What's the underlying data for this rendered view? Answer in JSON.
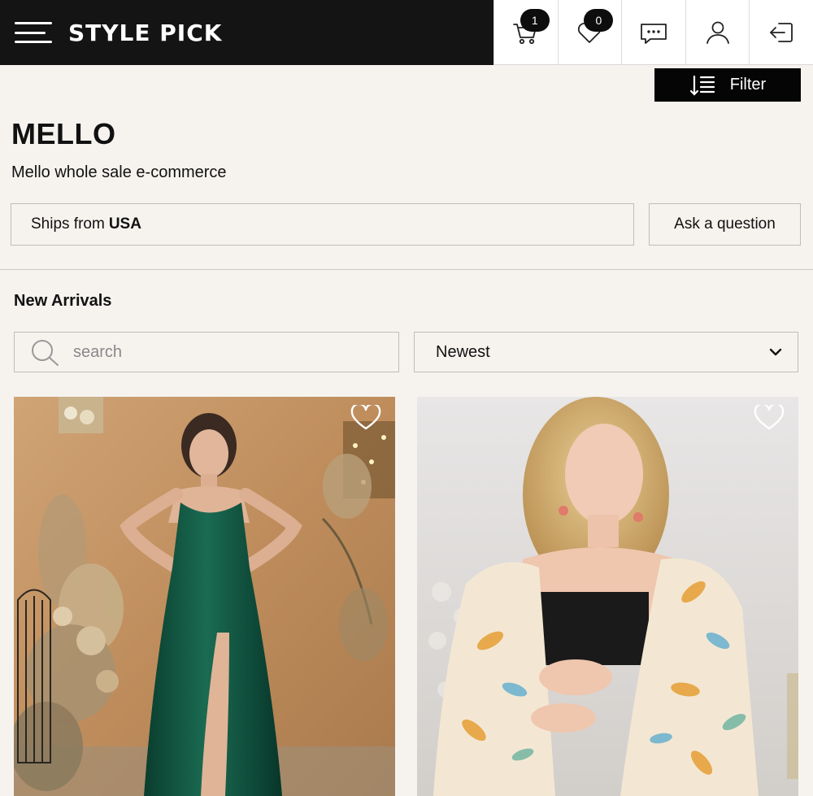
{
  "header": {
    "brand": "STYLE PICK",
    "cart_count": "1",
    "wishlist_count": "0"
  },
  "filter": {
    "label": "Filter"
  },
  "store": {
    "name": "MELLO",
    "description": "Mello whole sale e-commerce",
    "ships_from_label": "Ships from",
    "ships_from_value": "USA",
    "ask_button": "Ask a question"
  },
  "listing": {
    "section_title": "New Arrivals",
    "search_placeholder": "search",
    "sort_selected": "Newest"
  },
  "colors": {
    "header_bg": "#141414",
    "page_bg": "#f6f3ef",
    "accent": "#050505"
  },
  "icons": [
    "hamburger-menu-icon",
    "cart-icon",
    "heart-icon",
    "chat-icon",
    "user-icon",
    "logout-icon",
    "sort-filter-icon",
    "search-icon",
    "chevron-down-icon"
  ]
}
